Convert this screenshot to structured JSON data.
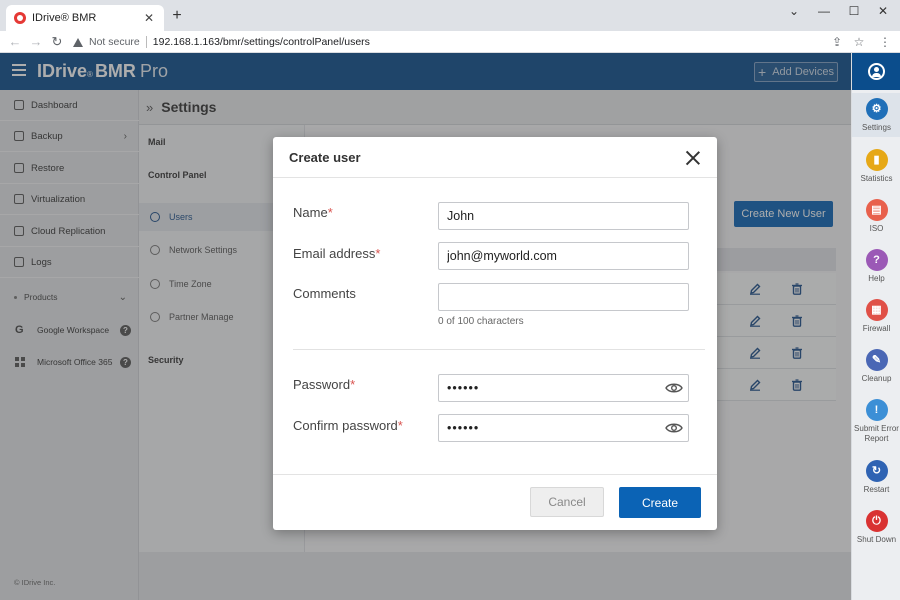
{
  "browser": {
    "tab_title": "IDrive® BMR",
    "tab_close": "✕",
    "new_tab": "+",
    "not_secure": "Not secure",
    "url": "192.168.1.163/bmr/settings/controlPanel/users"
  },
  "header": {
    "brand_main": "IDrive",
    "brand_reg": "®",
    "brand_bmr": "BMR",
    "brand_pro": "Pro",
    "add_devices": "Add Devices"
  },
  "sidebar": {
    "items": [
      {
        "label": "Dashboard"
      },
      {
        "label": "Backup"
      },
      {
        "label": "Restore"
      },
      {
        "label": "Virtualization"
      },
      {
        "label": "Cloud Replication"
      },
      {
        "label": "Logs"
      }
    ],
    "products_label": "Products",
    "products": [
      {
        "label": "Google Workspace"
      },
      {
        "label": "Microsoft Office 365"
      }
    ],
    "copyright": "© IDrive Inc."
  },
  "settings": {
    "title": "Settings",
    "groups": {
      "mail": "Mail",
      "control_panel": "Control Panel",
      "security": "Security"
    },
    "items": [
      {
        "label": "Users"
      },
      {
        "label": "Network Settings"
      },
      {
        "label": "Time Zone"
      },
      {
        "label": "Partner Manage"
      }
    ],
    "create_new_user": "Create New User"
  },
  "right_rail": [
    {
      "label": "Settings",
      "color": "#1f6fb8",
      "glyph": "⚙"
    },
    {
      "label": "Statistics",
      "color": "#e6a817",
      "glyph": "▮"
    },
    {
      "label": "ISO",
      "color": "#e8604c",
      "glyph": "▤"
    },
    {
      "label": "Help",
      "color": "#9b59b6",
      "glyph": "?"
    },
    {
      "label": "Firewall",
      "color": "#e05047",
      "glyph": "▦"
    },
    {
      "label": "Cleanup",
      "color": "#4a67b5",
      "glyph": "✎"
    },
    {
      "label": "Submit Error Report",
      "color": "#3c8fd6",
      "glyph": "!"
    },
    {
      "label": "Restart",
      "color": "#2f63b3",
      "glyph": "↻"
    },
    {
      "label": "Shut Down",
      "color": "#d93232",
      "glyph": "⏻"
    }
  ],
  "modal": {
    "title": "Create user",
    "name_label": "Name",
    "name_value": "John",
    "email_label": "Email address",
    "email_value": "john@myworld.com",
    "comments_label": "Comments",
    "comments_value": "",
    "char_count": "0 of 100 characters",
    "password_label": "Password",
    "password_value": "••••••",
    "confirm_label": "Confirm password",
    "confirm_value": "••••••",
    "required_mark": "*",
    "cancel": "Cancel",
    "create": "Create"
  }
}
